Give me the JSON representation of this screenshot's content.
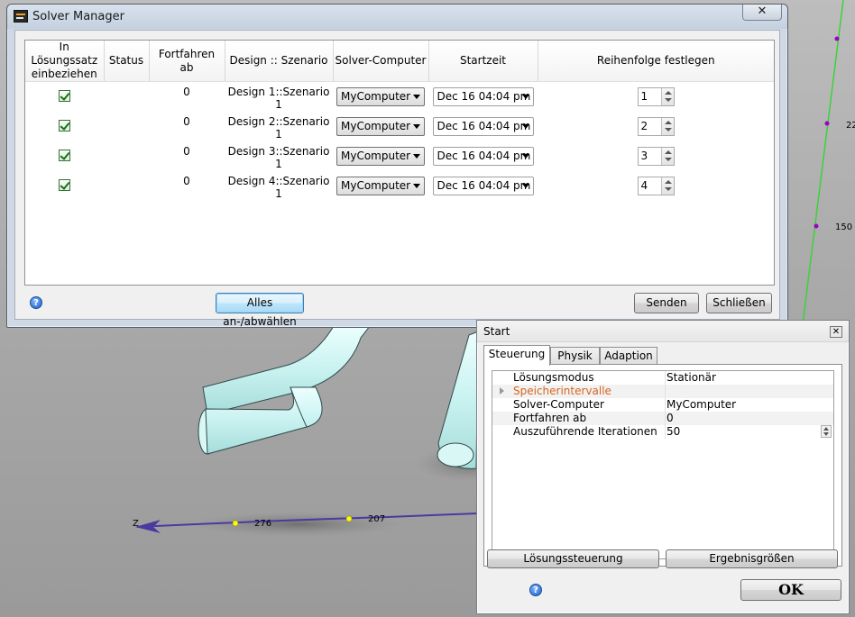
{
  "viewport": {
    "axis_z_label": "Z",
    "tick_276": "276",
    "tick_207": "207",
    "tick_150": "150",
    "tick_22": "22",
    "colors": {
      "pipe": "#c8f2f0",
      "axis_line": "#4a3aa0",
      "green_axis": "#3bd23b",
      "tick_dot_yellow": "#ffff00",
      "tick_dot_purple": "#9a00c8"
    }
  },
  "solver_manager": {
    "title": "Solver Manager",
    "close_label": "✕",
    "columns": {
      "include": "In Lösungssatz einbeziehen",
      "status": "Status",
      "continue_from": "Fortfahren ab",
      "design_scenario": "Design :: Szenario",
      "solver_computer": "Solver-Computer",
      "start_time": "Startzeit",
      "order": "Reihenfolge festlegen"
    },
    "rows": [
      {
        "checked": true,
        "status": "",
        "continue_from": "0",
        "design_scenario": "Design 1::Szenario 1",
        "computer": "MyComputer",
        "start_time": "Dec 16 04:04 pm",
        "order": "1"
      },
      {
        "checked": true,
        "status": "",
        "continue_from": "0",
        "design_scenario": "Design 2::Szenario 1",
        "computer": "MyComputer",
        "start_time": "Dec 16 04:04 pm",
        "order": "2"
      },
      {
        "checked": true,
        "status": "",
        "continue_from": "0",
        "design_scenario": "Design 3::Szenario 1",
        "computer": "MyComputer",
        "start_time": "Dec 16 04:04 pm",
        "order": "3"
      },
      {
        "checked": true,
        "status": "",
        "continue_from": "0",
        "design_scenario": "Design 4::Szenario 1",
        "computer": "MyComputer",
        "start_time": "Dec 16 04:04 pm",
        "order": "4"
      }
    ],
    "toggle_all_label": "Alles an-/abwählen",
    "send_label": "Senden",
    "close_button_label": "Schließen",
    "help_glyph": "?"
  },
  "start_dialog": {
    "title": "Start",
    "close_label": "✕",
    "tabs": [
      "Steuerung",
      "Physik",
      "Adaption"
    ],
    "active_tab": "Steuerung",
    "properties": [
      {
        "name": "Lösungsmodus",
        "value": "Stationär"
      },
      {
        "name": "Speicherintervalle",
        "value": ""
      },
      {
        "name": "Solver-Computer",
        "value": "MyComputer"
      },
      {
        "name": "Fortfahren ab",
        "value": "0"
      },
      {
        "name": "Auszuführende Iterationen",
        "value": "50"
      }
    ],
    "solution_control_label": "Lösungssteuerung",
    "result_quantities_label": "Ergebnisgrößen",
    "ok_label": "OK",
    "help_glyph": "?"
  }
}
